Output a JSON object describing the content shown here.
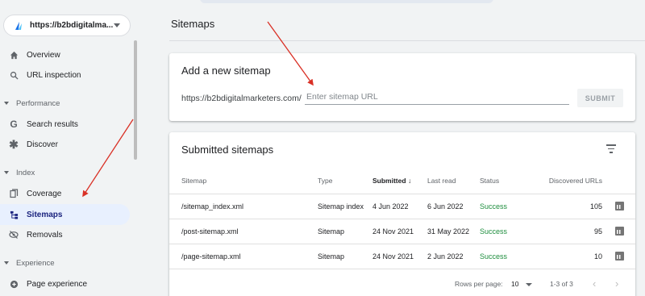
{
  "sidebar": {
    "property": "https://b2bdigitalma...",
    "items": {
      "overview": "Overview",
      "url_inspection": "URL inspection",
      "performance_section": "Performance",
      "search_results": "Search results",
      "discover": "Discover",
      "index_section": "Index",
      "coverage": "Coverage",
      "sitemaps": "Sitemaps",
      "removals": "Removals",
      "experience_section": "Experience",
      "page_experience": "Page experience"
    }
  },
  "main": {
    "title": "Sitemaps",
    "add_card": {
      "heading": "Add a new sitemap",
      "prefix": "https://b2bdigitalmarketers.com/",
      "placeholder": "Enter sitemap URL",
      "submit": "SUBMIT"
    },
    "submitted_card": {
      "heading": "Submitted sitemaps",
      "columns": {
        "sitemap": "Sitemap",
        "type": "Type",
        "submitted": "Submitted",
        "last_read": "Last read",
        "status": "Status",
        "discovered": "Discovered URLs"
      },
      "rows": [
        {
          "sitemap": "/sitemap_index.xml",
          "type": "Sitemap index",
          "submitted": "4 Jun 2022",
          "last_read": "6 Jun 2022",
          "status": "Success",
          "discovered": "105"
        },
        {
          "sitemap": "/post-sitemap.xml",
          "type": "Sitemap",
          "submitted": "24 Nov 2021",
          "last_read": "31 May 2022",
          "status": "Success",
          "discovered": "95"
        },
        {
          "sitemap": "/page-sitemap.xml",
          "type": "Sitemap",
          "submitted": "24 Nov 2021",
          "last_read": "2 Jun 2022",
          "status": "Success",
          "discovered": "10"
        }
      ],
      "pager": {
        "rows_per_page_label": "Rows per page:",
        "rows_per_page": "10",
        "range": "1-3 of 3"
      }
    }
  },
  "colors": {
    "accent": "#1a73e8",
    "active_bg": "#e8f0fe",
    "success": "#1e8e3e",
    "annotation_arrow": "#d93025"
  }
}
